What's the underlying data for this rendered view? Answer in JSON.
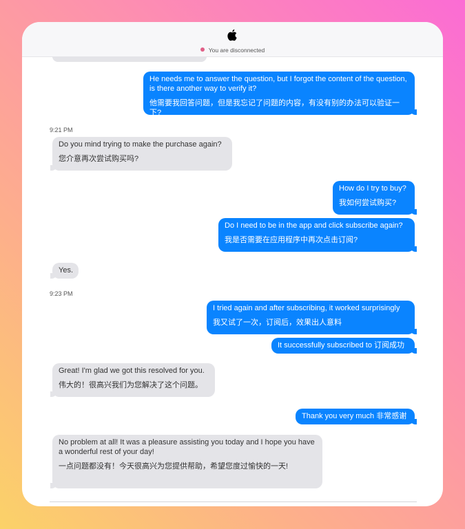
{
  "header": {
    "logo_icon": "apple-logo-icon",
    "status_text": "You are disconnected",
    "status_color": "#e05f87"
  },
  "colors": {
    "sent_bubble": "#0a84ff",
    "received_bubble": "#e4e4e8",
    "background_gradient": [
      "#fbd268",
      "#fd8fb0",
      "#fb6cd4"
    ]
  },
  "conversation": [
    {
      "side": "sent",
      "en": "He needs me to answer the question, but I forgot the content of the question, is there another way to verify it?",
      "zh": "他需要我回答问题，但是我忘记了问题的内容，有没有别的办法可以验证一下?"
    },
    {
      "time": "9:21 PM"
    },
    {
      "side": "received",
      "en": "Do you mind trying to make the purchase again?",
      "zh": "您介意再次尝试购买吗?"
    },
    {
      "side": "sent",
      "en": "How do I try to buy?",
      "zh": "我如何尝试购买?"
    },
    {
      "side": "sent",
      "en": "Do I need to be in the app and click subscribe again?",
      "zh": "我是否需要在应用程序中再次点击订阅?"
    },
    {
      "side": "received",
      "en": "Yes."
    },
    {
      "time": "9:23 PM"
    },
    {
      "side": "sent",
      "en": "I tried again and after subscribing, it worked surprisingly",
      "zh": "我又试了一次，订阅后，效果出人意料"
    },
    {
      "side": "sent",
      "en": "It successfully subscribed to 订阅成功"
    },
    {
      "side": "received",
      "en": "Great! I'm glad we got this resolved for you.",
      "zh": "伟大的！很高兴我们为您解决了这个问题。"
    },
    {
      "side": "sent",
      "en": "Thank you very much 非常感谢"
    },
    {
      "side": "received",
      "en": "No problem at all! It was a pleasure assisting you today and I hope you have a wonderful rest of your day!",
      "zh": "一点问题都没有！今天很高兴为您提供帮助，希望您度过愉快的一天!"
    }
  ]
}
